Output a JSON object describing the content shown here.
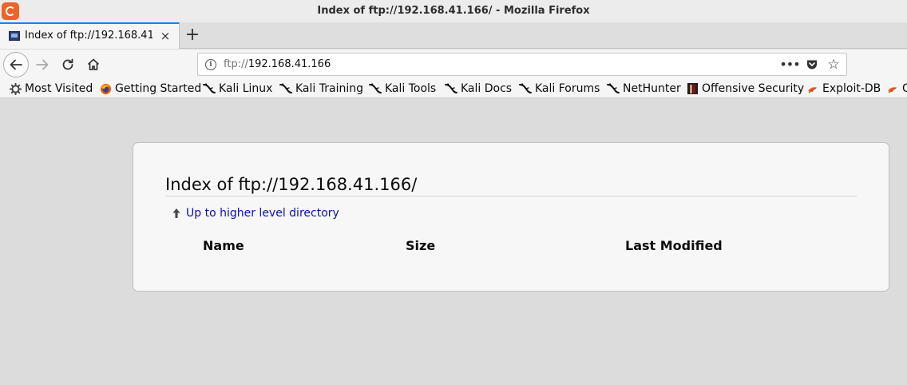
{
  "window": {
    "title": "Index of ftp://192.168.41.166/ - Mozilla Firefox"
  },
  "tab": {
    "title": "Index of ftp://192.168.41.166/",
    "close_label": "×",
    "new_tab_label": "+"
  },
  "urlbar": {
    "scheme": "ftp://",
    "host": "192.168.41.166",
    "more_label": "•••",
    "bookmark_label": "☆"
  },
  "bookmarks": [
    {
      "label": "Most Visited",
      "icon": "gear-icon"
    },
    {
      "label": "Getting Started",
      "icon": "firefox-icon"
    },
    {
      "label": "Kali Linux",
      "icon": "kali-dragon-icon"
    },
    {
      "label": "Kali Training",
      "icon": "kali-dragon-icon"
    },
    {
      "label": "Kali Tools",
      "icon": "kali-dragon-icon"
    },
    {
      "label": "Kali Docs",
      "icon": "kali-dragon-icon"
    },
    {
      "label": "Kali Forums",
      "icon": "kali-dragon-icon"
    },
    {
      "label": "NetHunter",
      "icon": "kali-dragon-icon"
    },
    {
      "label": "Offensive Security",
      "icon": "offsec-icon"
    },
    {
      "label": "Exploit-DB",
      "icon": "exploit-db-icon"
    },
    {
      "label": "G",
      "icon": "exploit-db-icon"
    }
  ],
  "page": {
    "heading": "Index of ftp://192.168.41.166/",
    "up_link": "Up to higher level directory",
    "columns": {
      "name": "Name",
      "size": "Size",
      "modified": "Last Modified"
    },
    "link_color": "#0d0db8"
  },
  "colors": {
    "accent": "#0a84ff",
    "firefox_orange": "#e8652b"
  }
}
